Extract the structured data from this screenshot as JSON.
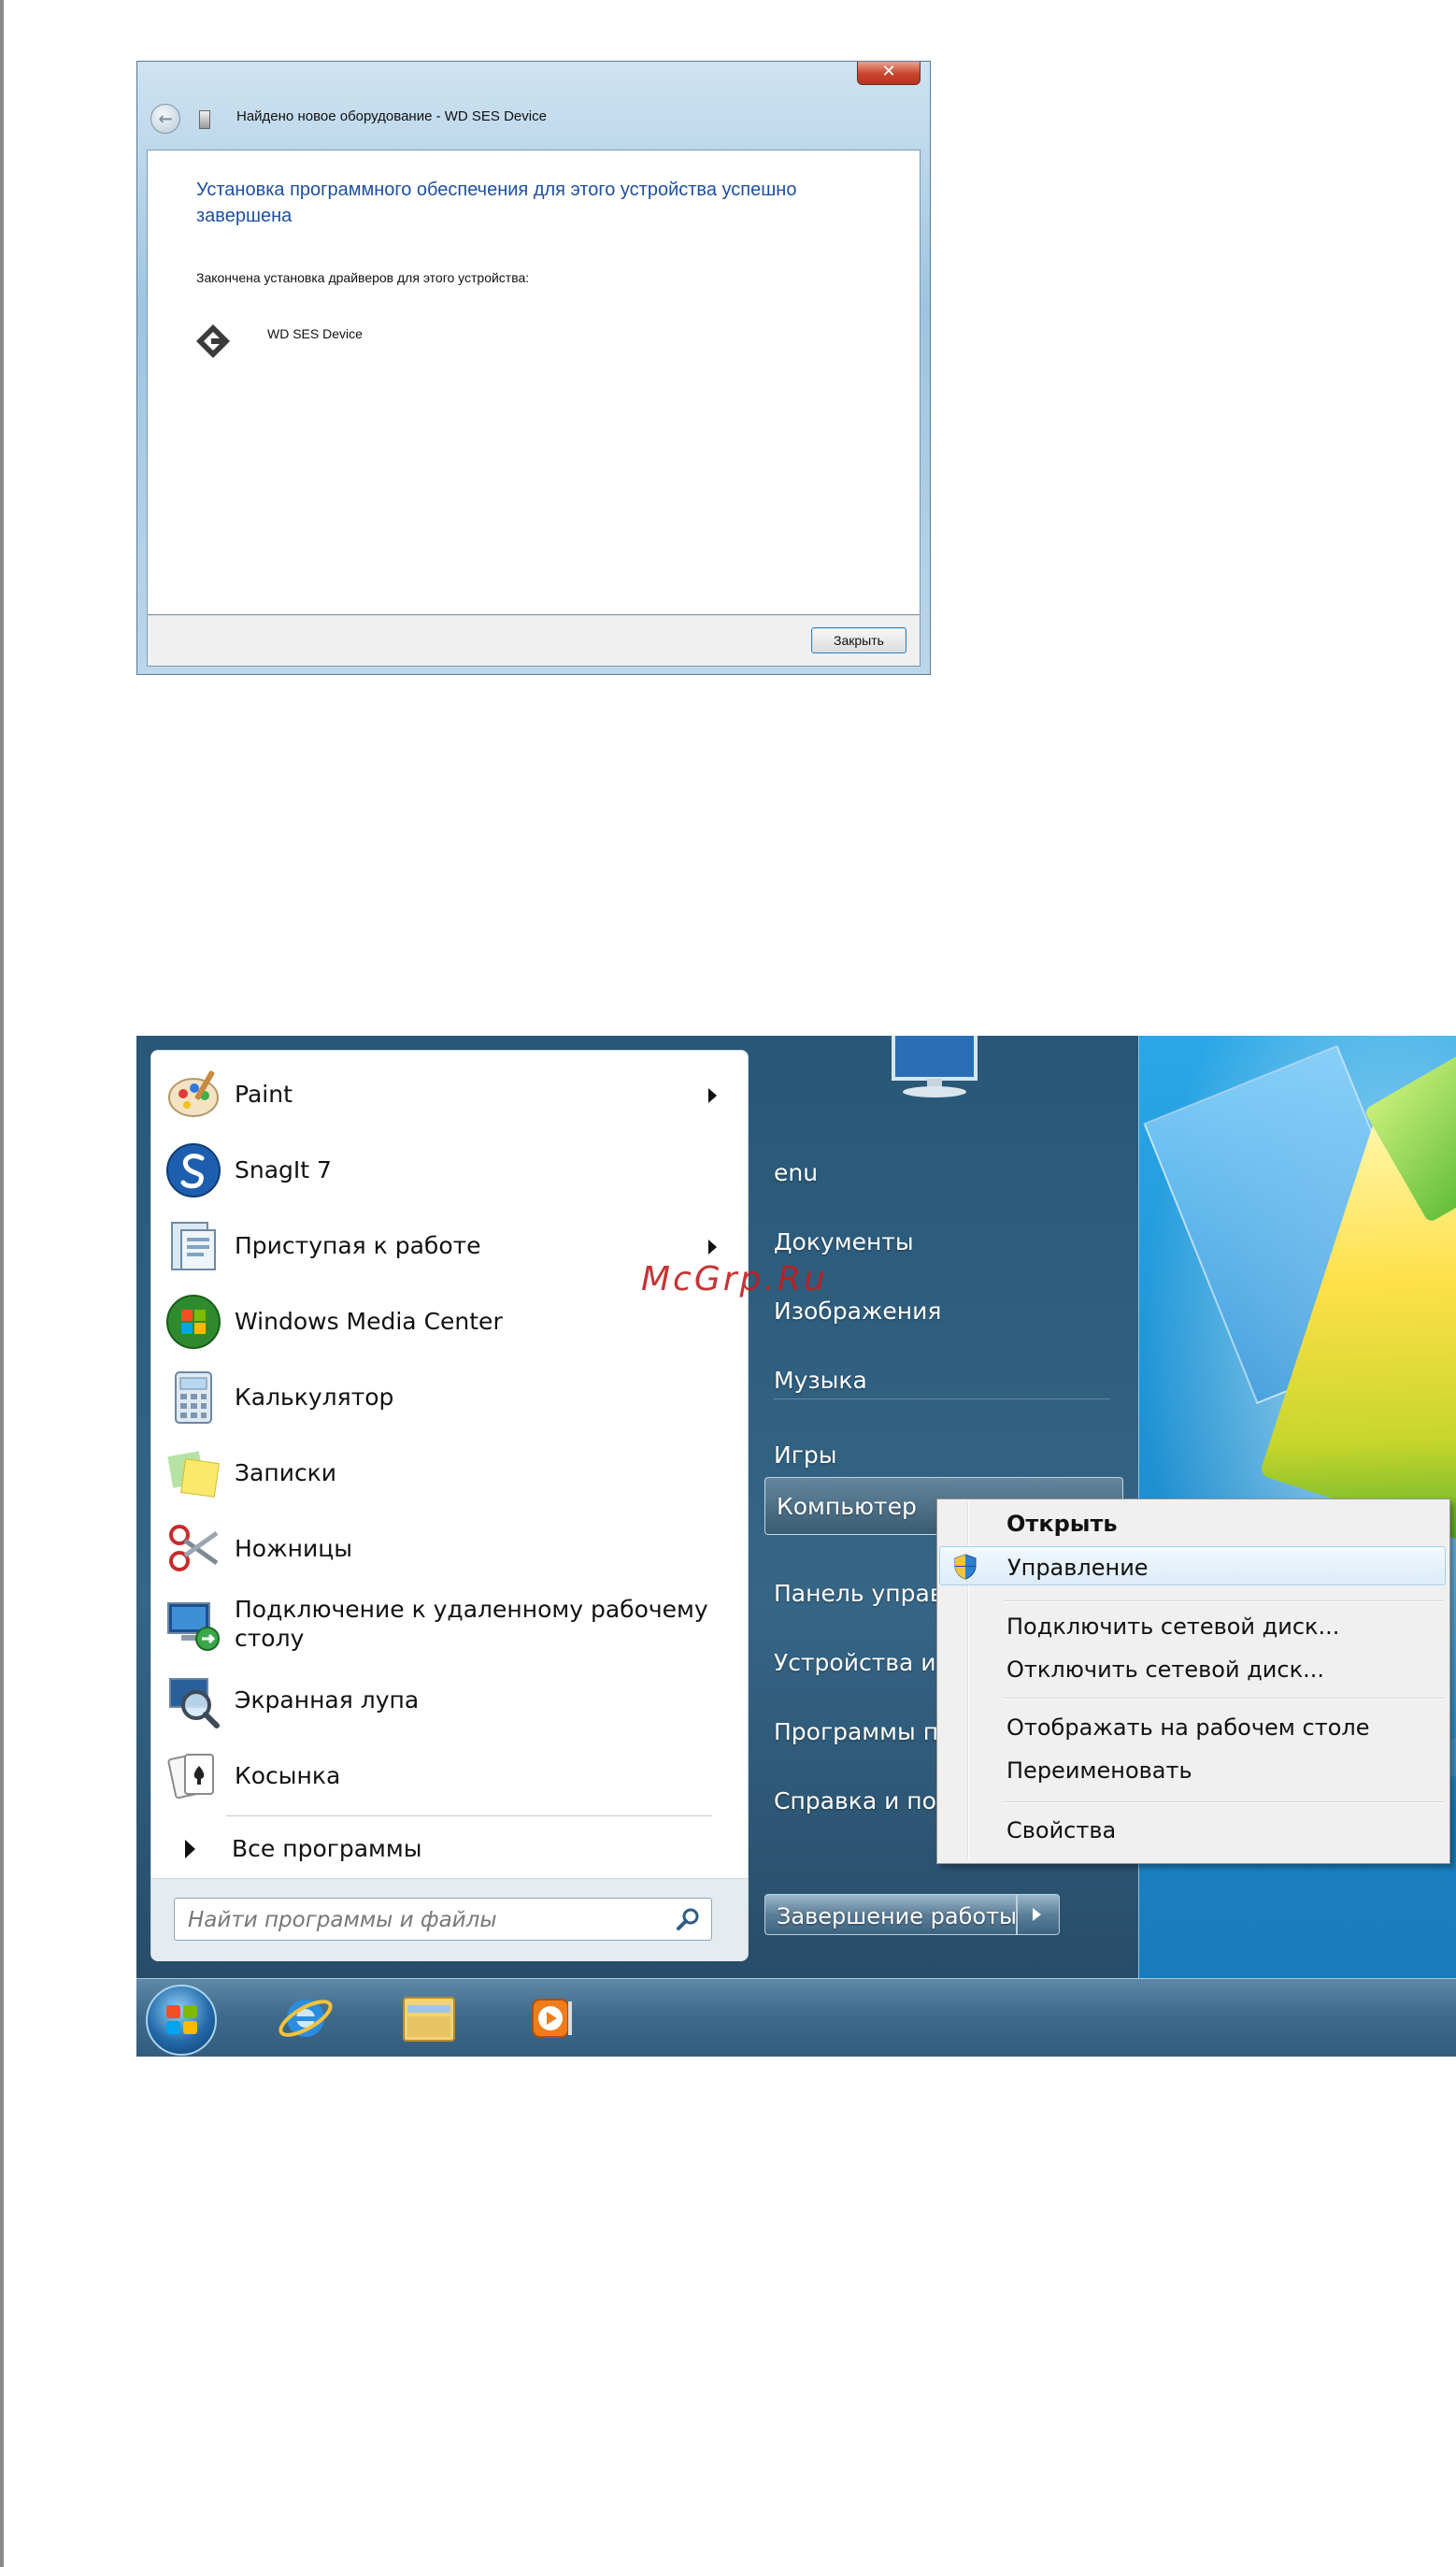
{
  "dialog": {
    "title": "Найдено новое оборудование - WD SES Device",
    "close_glyph": "✕",
    "heading": "Установка программного обеспечения для этого устройства успешно завершена",
    "subtext": "Закончена установка драйверов для этого устройства:",
    "device_name": "WD SES Device",
    "close_button": "Закрыть"
  },
  "watermark": "McGrp.Ru",
  "start_menu": {
    "programs": [
      {
        "label": "Paint",
        "icon": "paint-icon",
        "submenu": true
      },
      {
        "label": "SnagIt 7",
        "icon": "snagit-icon",
        "submenu": false
      },
      {
        "label": "Приступая к работе",
        "icon": "getting-started-icon",
        "submenu": true
      },
      {
        "label": "Windows Media Center",
        "icon": "media-center-icon",
        "submenu": false
      },
      {
        "label": "Калькулятор",
        "icon": "calculator-icon",
        "submenu": false
      },
      {
        "label": "Записки",
        "icon": "sticky-notes-icon",
        "submenu": false
      },
      {
        "label": "Ножницы",
        "icon": "scissors-icon",
        "submenu": false
      },
      {
        "label": "Подключение к удаленному рабочему столу",
        "icon": "remote-desktop-icon",
        "submenu": false
      },
      {
        "label": "Экранная лупа",
        "icon": "magnifier-icon",
        "submenu": false
      },
      {
        "label": "Косынка",
        "icon": "solitaire-icon",
        "submenu": false
      }
    ],
    "all_programs": "Все программы",
    "search_placeholder": "Найти программы и файлы",
    "right_items": [
      "enu",
      "Документы",
      "Изображения",
      "Музыка",
      "Игры",
      "Компьютер",
      "Панель управл",
      "Устройства и п",
      "Программы по",
      "Справка и под"
    ],
    "shutdown": "Завершение работы"
  },
  "context_menu": {
    "items": [
      {
        "label": "Открыть",
        "bold": true
      },
      {
        "label": "Управление",
        "highlighted": true,
        "icon": "uac-shield-icon"
      },
      {
        "label": "Подключить сетевой диск..."
      },
      {
        "label": "Отключить сетевой диск..."
      },
      {
        "label": "Отображать на рабочем столе"
      },
      {
        "label": "Переименовать"
      },
      {
        "label": "Свойства"
      }
    ]
  },
  "taskbar": {
    "pinned": [
      "internet-explorer-icon",
      "windows-explorer-icon",
      "media-player-icon"
    ]
  },
  "colors": {
    "dialog_heading": "#1e4fa3",
    "watermark": "#c21d1d",
    "menu_frame": "#385f7e"
  }
}
